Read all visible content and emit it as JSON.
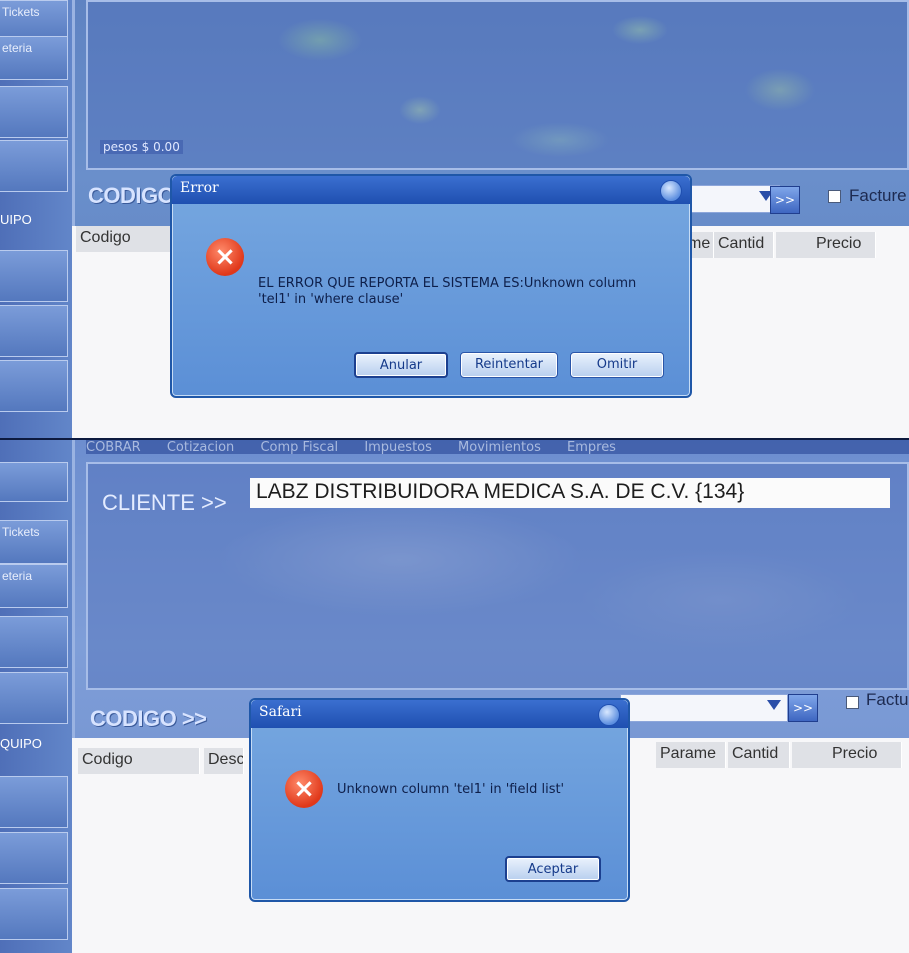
{
  "top": {
    "sidebar": {
      "items": [
        "Tickets",
        "eteria"
      ],
      "label": "UIPO"
    },
    "saldo": "pesos $ 0.00",
    "codigo_label": "CODIGO",
    "factura_label": "Facture",
    "go_label": ">>",
    "grid_headers": [
      "Codigo",
      "me",
      "Cantid",
      "Precio"
    ],
    "dialog": {
      "title": "Error",
      "message_line1": "EL ERROR QUE REPORTA EL SISTEMA ES:Unknown column",
      "message_line2": "'tel1' in 'where clause'",
      "buttons": {
        "cancel": "Anular",
        "retry": "Reintentar",
        "ignore": "Omitir"
      }
    }
  },
  "bottom": {
    "menu": [
      "COBRAR",
      "Cotizacion",
      "Comp Fiscal",
      "Impuestos",
      "Movimientos",
      "Empres"
    ],
    "sidebar": {
      "items": [
        "Tickets",
        "eteria"
      ],
      "label": "QUIPO"
    },
    "cliente_label": "CLIENTE >>",
    "cliente_value": "LABZ DISTRIBUIDORA MEDICA S.A. DE C.V. {134}",
    "codigo_label": "CODIGO >>",
    "factura_label": "Factu",
    "go_label": ">>",
    "grid_headers": [
      "Codigo",
      "Desc",
      "Parame",
      "Cantid",
      "Precio"
    ],
    "dialog": {
      "title": "Safari",
      "message": "Unknown column 'tel1' in 'field list'",
      "buttons": {
        "ok": "Aceptar"
      }
    }
  },
  "colors": {
    "dialog_title": "#1f4fb0",
    "dialog_body": "#6a9bdc",
    "error_icon": "#e0381a",
    "background": "#6a8bcb"
  }
}
